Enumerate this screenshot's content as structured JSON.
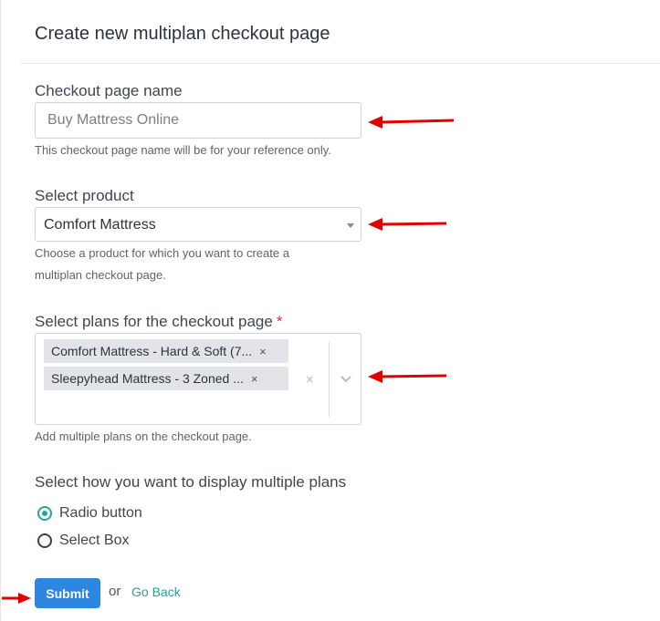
{
  "page": {
    "title": "Create new multiplan checkout page"
  },
  "form": {
    "checkout_name": {
      "label": "Checkout page name",
      "placeholder": "Buy Mattress Online",
      "help": "This checkout page name will be for your reference only."
    },
    "product": {
      "label": "Select product",
      "selected": "Comfort Mattress",
      "help": "Choose a product for which you want to create a multiplan checkout page."
    },
    "plans": {
      "label": "Select plans for the checkout page",
      "required_mark": "*",
      "selected": [
        {
          "label": "Comfort Mattress - Hard & Soft (7...",
          "remove": "×"
        },
        {
          "label": "Sleepyhead Mattress - 3 Zoned ...",
          "remove": "×"
        }
      ],
      "clear": "×",
      "help": "Add multiple plans on the checkout page."
    },
    "display_mode": {
      "label": "Select how you want to display multiple plans",
      "options": [
        {
          "label": "Radio button",
          "checked": true
        },
        {
          "label": "Select Box",
          "checked": false
        }
      ]
    }
  },
  "actions": {
    "submit": "Submit",
    "or": "or",
    "go_back": "Go Back"
  },
  "icons": {
    "dropdown": "caret-down-icon",
    "multiselect": "chevron-down-icon",
    "annotation": "red-arrow-icon"
  },
  "colors": {
    "primary_button": "#2f86e0",
    "link": "#20a39e",
    "radio_checked": "#26a69a",
    "annotation_arrow": "#e00000",
    "required": "#e02d2d"
  }
}
